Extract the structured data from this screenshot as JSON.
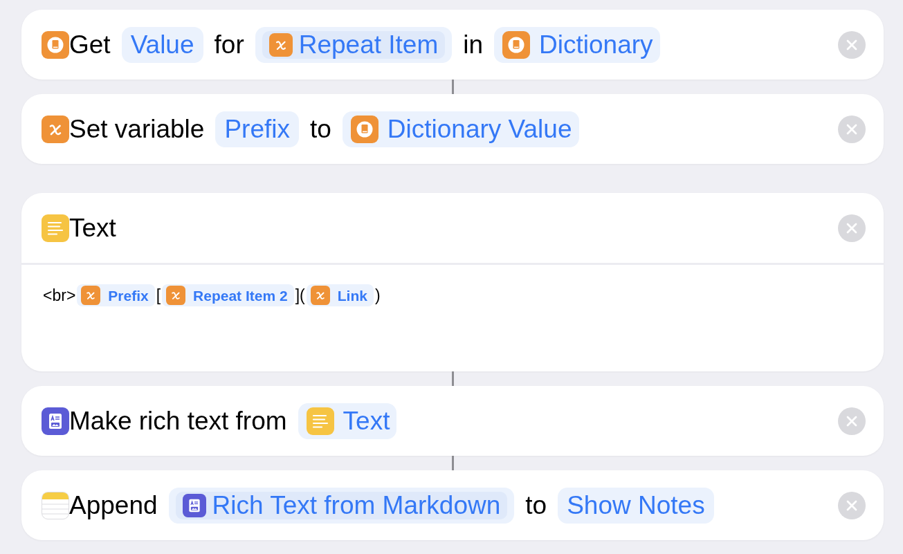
{
  "actions": [
    {
      "kind": "dictionary",
      "linked": false,
      "parts": [
        {
          "kind": "label",
          "text": "Get"
        },
        {
          "kind": "param",
          "text": "Value"
        },
        {
          "kind": "label",
          "text": "for"
        },
        {
          "kind": "variable",
          "text": "Repeat Item",
          "highlighted": true
        },
        {
          "kind": "label",
          "text": "in"
        },
        {
          "kind": "dictionary",
          "text": "Dictionary",
          "highlighted": false
        }
      ]
    },
    {
      "kind": "variable",
      "linked": true,
      "parts": [
        {
          "kind": "label",
          "text": "Set variable"
        },
        {
          "kind": "param",
          "text": "Prefix"
        },
        {
          "kind": "label",
          "text": "to"
        },
        {
          "kind": "dictionary",
          "text": "Dictionary Value",
          "highlighted": false
        }
      ]
    },
    {
      "kind": "text",
      "linked": false,
      "parts": [
        {
          "kind": "label",
          "text": "Text"
        }
      ],
      "body": [
        {
          "kind": "label",
          "text": "<br>"
        },
        {
          "kind": "variable",
          "text": "Prefix"
        },
        {
          "kind": "label",
          "text": "["
        },
        {
          "kind": "variable",
          "text": "Repeat Item 2"
        },
        {
          "kind": "label",
          "text": "]("
        },
        {
          "kind": "variable",
          "text": "Link"
        },
        {
          "kind": "label",
          "text": ")"
        }
      ]
    },
    {
      "kind": "rich-text",
      "linked": true,
      "parts": [
        {
          "kind": "label",
          "text": "Make rich text from"
        },
        {
          "kind": "text",
          "text": "Text",
          "highlighted": false
        }
      ]
    },
    {
      "kind": "notes",
      "linked": true,
      "parts": [
        {
          "kind": "label",
          "text": "Append"
        },
        {
          "kind": "rich-text",
          "text": "Rich Text from Markdown",
          "highlighted": true
        },
        {
          "kind": "label",
          "text": "to"
        },
        {
          "kind": "param",
          "text": "Show Notes"
        }
      ]
    }
  ]
}
